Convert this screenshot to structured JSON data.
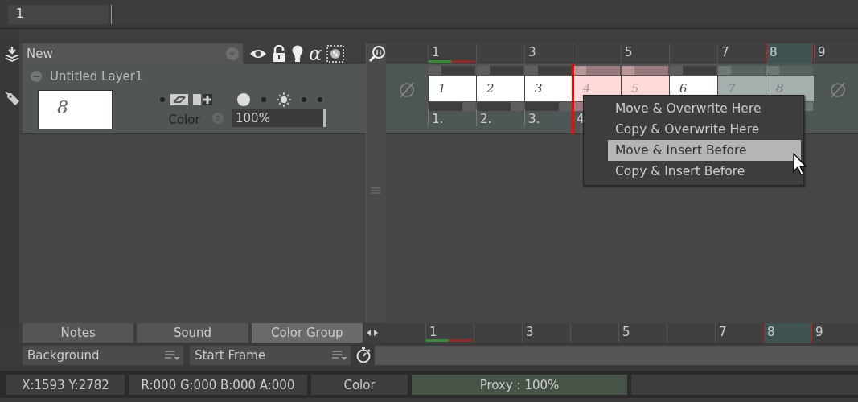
{
  "top_bar": {
    "field_value": "1"
  },
  "layer_panel": {
    "header": {
      "label": "New",
      "alpha_symbol": "α"
    },
    "layer": {
      "name": "Untitled Layer1",
      "expanded": true,
      "thumbnail_text": "8",
      "color_label": "Color",
      "opacity": "100%"
    }
  },
  "timeline": {
    "ruler": [
      {
        "label": "1",
        "current": false
      },
      {
        "current": false
      },
      {
        "label": "3",
        "current": false
      },
      {
        "current": false
      },
      {
        "label": "5",
        "current": false
      },
      {
        "current": false
      },
      {
        "label": "7",
        "current": false
      },
      {
        "label": "8",
        "current": true
      },
      {
        "label": "9",
        "current": false
      }
    ],
    "frames": [
      {
        "drawing": "1",
        "label": "1.",
        "dragged": false,
        "selected": false,
        "insert_here": false
      },
      {
        "drawing": "2",
        "label": "2.",
        "dragged": false,
        "selected": false,
        "insert_here": false
      },
      {
        "drawing": "3",
        "label": "3.",
        "dragged": false,
        "selected": false,
        "insert_here": false
      },
      {
        "drawing": "4",
        "label": "4",
        "dragged": true,
        "selected": false,
        "insert_here": true
      },
      {
        "drawing": "5",
        "dragged": true,
        "selected": false,
        "insert_here": false
      },
      {
        "drawing": "6",
        "dragged": false,
        "selected": false,
        "insert_here": false
      },
      {
        "drawing": "7",
        "dragged": false,
        "selected": true,
        "insert_here": false
      },
      {
        "drawing": "8",
        "dragged": false,
        "selected": true,
        "insert_here": false
      }
    ]
  },
  "context_menu": {
    "items": [
      {
        "label": "Move & Overwrite Here",
        "selected": false
      },
      {
        "label": "Copy & Overwrite Here",
        "selected": false
      },
      {
        "label": "Move & Insert Before",
        "selected": true
      },
      {
        "label": "Copy & Insert Before",
        "selected": false
      }
    ]
  },
  "bottom_tabs": [
    {
      "label": "Notes",
      "selected": false
    },
    {
      "label": "Sound",
      "selected": false
    },
    {
      "label": "Color Group",
      "selected": true
    }
  ],
  "bottom_ruler": [
    {
      "label": "1",
      "current": false
    },
    {
      "current": false
    },
    {
      "label": "3",
      "current": false
    },
    {
      "current": false
    },
    {
      "label": "5",
      "current": false
    },
    {
      "current": false
    },
    {
      "label": "7",
      "current": false
    },
    {
      "label": "8",
      "current": true
    },
    {
      "label": "9",
      "current": false
    }
  ],
  "dropdowns": [
    {
      "value": "Background"
    },
    {
      "value": "Start Frame"
    }
  ],
  "status_bar": [
    {
      "text": "X:1593  Y:2782",
      "kind": "plain"
    },
    {
      "text": "R:000 G:000 B:000 A:000",
      "kind": "plain"
    },
    {
      "text": "Color",
      "kind": "plain"
    },
    {
      "text": "Proxy : 100%",
      "kind": "proxy"
    }
  ]
}
